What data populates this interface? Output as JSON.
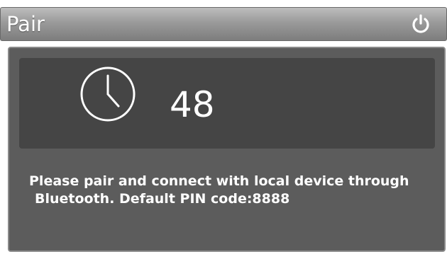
{
  "header": {
    "title": "Pair",
    "power_icon": "power-icon"
  },
  "timer": {
    "clock_icon": "clock-icon",
    "countdown": "48"
  },
  "message": {
    "line1": "Please pair and connect with local device through",
    "line2": "Bluetooth. Default PIN code:8888"
  },
  "colors": {
    "header_top": "#bdbdbd",
    "header_bottom": "#7d7d7d",
    "panel": "#5c5c5c",
    "timer_box": "#454545",
    "text": "#ffffff"
  }
}
